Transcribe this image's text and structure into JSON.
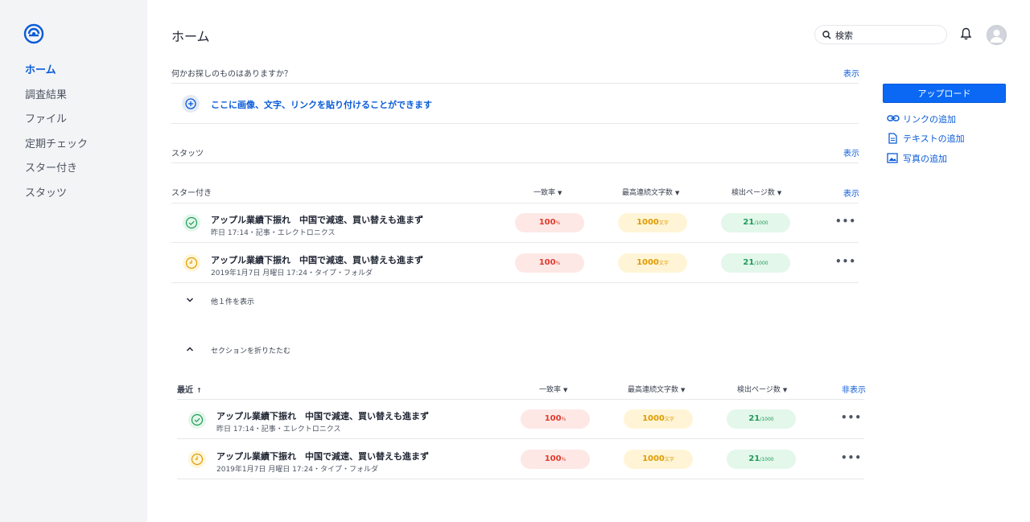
{
  "sidebar": {
    "items": [
      {
        "label": "ホーム",
        "active": true
      },
      {
        "label": "調査結果",
        "active": false
      },
      {
        "label": "ファイル",
        "active": false
      },
      {
        "label": "定期チェック",
        "active": false
      },
      {
        "label": "スター付き",
        "active": false
      },
      {
        "label": "スタッツ",
        "active": false
      }
    ]
  },
  "header": {
    "title": "ホーム",
    "search_placeholder": "検索"
  },
  "finder": {
    "label": "何かお探しのものはありますか？",
    "show": "表示",
    "paste_hint": "ここに画像、文字、リンクを貼り付けることができます"
  },
  "stats_section": {
    "label": "スタッツ",
    "show": "表示"
  },
  "starred": {
    "label": "スター付き",
    "show": "表示",
    "columns": [
      "一致率",
      "最高連続文字数",
      "検出ページ数"
    ],
    "rows": [
      {
        "status": "check",
        "title": "アップル業績下振れ　中国で減速、買い替えも進まず",
        "meta": "昨日 17:14・記事・エレクトロニクス",
        "match": "100",
        "match_unit": "%",
        "chars": "1000",
        "chars_unit": "文字",
        "pages": "21",
        "pages_total": "/1000"
      },
      {
        "status": "clock",
        "title": "アップル業績下振れ　中国で減速、買い替えも進まず",
        "meta": "2019年1月7日 月曜日 17:24・タイプ・フォルダ",
        "match": "100",
        "match_unit": "%",
        "chars": "1000",
        "chars_unit": "文字",
        "pages": "21",
        "pages_total": "/1000"
      }
    ],
    "more": "他１件を表示",
    "collapse": "セクションを折りたたむ"
  },
  "recent": {
    "label": "最近",
    "sort_icon": "arrow-up",
    "hide": "非表示",
    "columns": [
      "一致率",
      "最高連続文字数",
      "検出ページ数"
    ],
    "rows": [
      {
        "status": "check",
        "title": "アップル業績下振れ　中国で減速、買い替えも進まず",
        "meta": "昨日 17:14・記事・エレクトロニクス",
        "match": "100",
        "match_unit": "%",
        "chars": "1000",
        "chars_unit": "文字",
        "pages": "21",
        "pages_total": "/1000"
      },
      {
        "status": "clock",
        "title": "アップル業績下振れ　中国で減速、買い替えも進まず",
        "meta": "2019年1月7日 月曜日 17:24・タイプ・フォルダ",
        "match": "100",
        "match_unit": "%",
        "chars": "1000",
        "chars_unit": "文字",
        "pages": "21",
        "pages_total": "/1000"
      }
    ]
  },
  "actions": {
    "upload": "アップロード",
    "add_link": "リンクの追加",
    "add_text": "テキストの追加",
    "add_photo": "写真の追加"
  },
  "colors": {
    "accent": "#0a5bd9",
    "sidebar_bg": "#f3f4f6",
    "match_bg": "#fde8e6",
    "match_fg": "#e03a2c",
    "chars_bg": "#fff5d6",
    "chars_fg": "#e09a00",
    "pages_bg": "#e3f7ea",
    "pages_fg": "#1f9b59"
  }
}
